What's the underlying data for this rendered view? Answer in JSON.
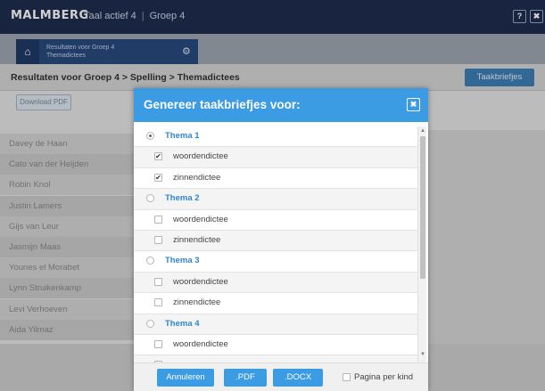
{
  "app": {
    "logo": "MALMBERG",
    "breadcrumb": [
      "Taal actief 4",
      "Groep 4"
    ],
    "help_label": "?",
    "close_label": "✖"
  },
  "tab": {
    "home_icon": "⌂",
    "title_line1": "Resultaten voor Groep 4",
    "title_line2": "Themadictees",
    "gear_icon": "⚙"
  },
  "header": {
    "title": "Resultaten voor Groep 4 > Spelling > Themadictees",
    "taakbriefjes_button": "Taakbriefjes"
  },
  "download_pdf": "Download PDF",
  "students": [
    "Davey de Haan",
    "Cato van der Heijden",
    "Robin Knol",
    "Justin Lamers",
    "Gijs van Leur",
    "Jasmijn Maas",
    "Younes el Morabet",
    "Lynn Struikenkamp",
    "Levi Verhoeven",
    "Aida Yilmaz"
  ],
  "modal": {
    "title": "Genereer taakbriefjes voor:",
    "close_icon": "✖",
    "rows": [
      {
        "kind": "thema",
        "label": "Thema 1",
        "selected": true
      },
      {
        "kind": "item",
        "label": "woordendictee",
        "checked": true
      },
      {
        "kind": "item",
        "label": "zinnendictee",
        "checked": true
      },
      {
        "kind": "thema",
        "label": "Thema 2",
        "selected": false
      },
      {
        "kind": "item",
        "label": "woordendictee",
        "checked": false
      },
      {
        "kind": "item",
        "label": "zinnendictee",
        "checked": false
      },
      {
        "kind": "thema",
        "label": "Thema 3",
        "selected": false
      },
      {
        "kind": "item",
        "label": "woordendictee",
        "checked": false
      },
      {
        "kind": "item",
        "label": "zinnendictee",
        "checked": false
      },
      {
        "kind": "thema",
        "label": "Thema 4",
        "selected": false
      },
      {
        "kind": "item",
        "label": "woordendictee",
        "checked": false
      },
      {
        "kind": "item",
        "label": "",
        "checked": false
      }
    ],
    "footer": {
      "annuleren": "Annuleren",
      "pdf": ".PDF",
      "docx": ".DOCX",
      "pagina_per_kind": "Pagina per kind",
      "pagina_per_kind_checked": false
    }
  },
  "colors": {
    "topbar": "#1e2d4f",
    "accent": "#3b9be3",
    "thema_text": "#2f86cf"
  }
}
